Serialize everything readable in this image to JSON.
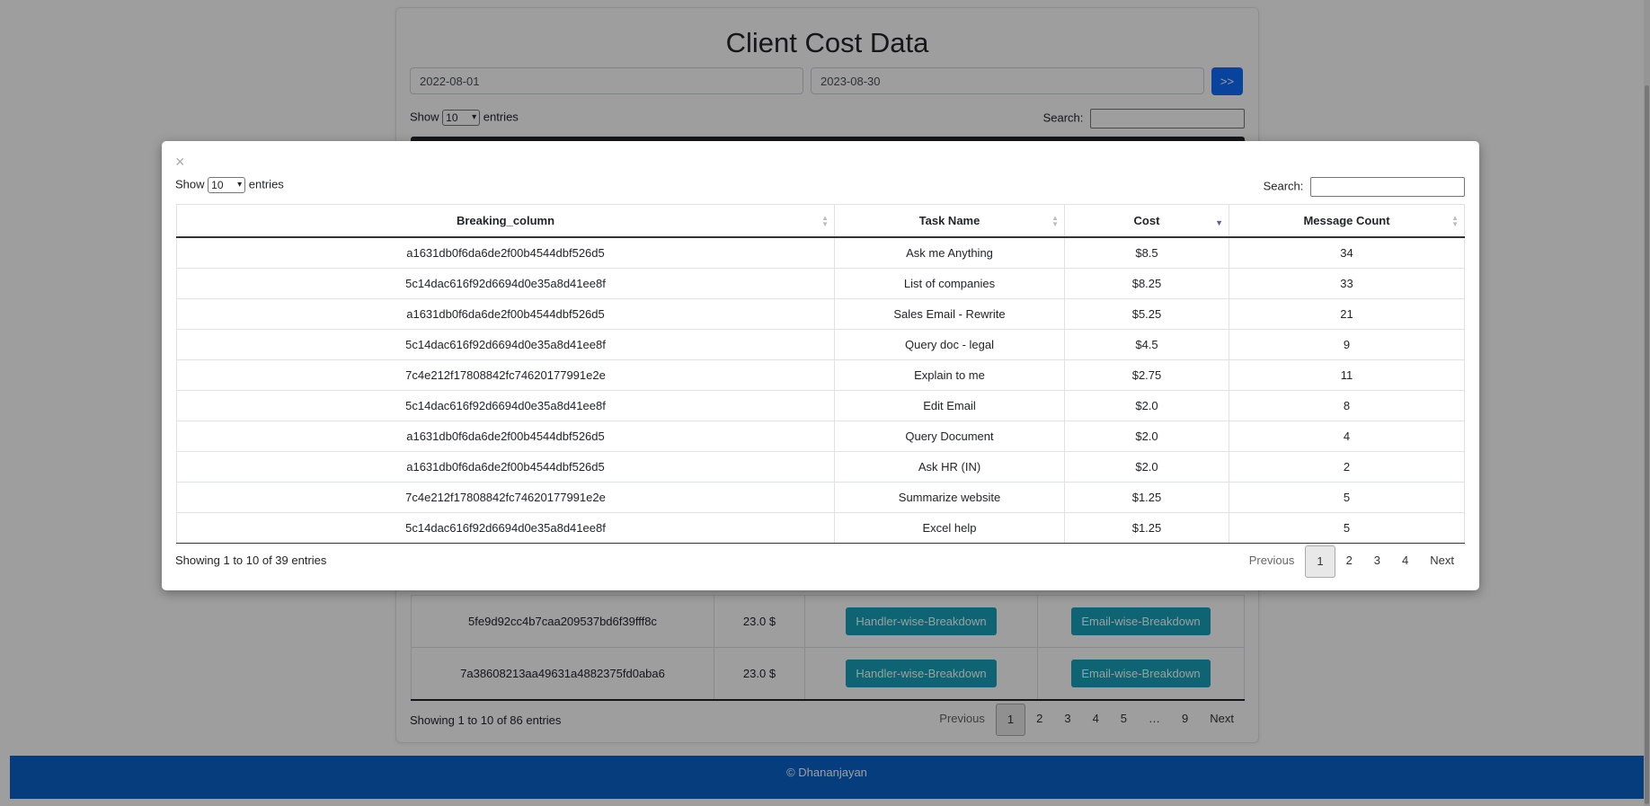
{
  "background": {
    "title": "Client Cost Data",
    "start_date": "2022-08-01",
    "end_date": "2023-08-30",
    "go_label": ">>",
    "length": {
      "show": "Show",
      "value": "10",
      "entries": "entries"
    },
    "search_label": "Search:",
    "rows": [
      {
        "id": "5fe9d92cc4b7caa209537bd6f39fff8c",
        "cost": "23.0 $",
        "handler_btn": "Handler-wise-Breakdown",
        "email_btn": "Email-wise-Breakdown"
      },
      {
        "id": "7a38608213aa49631a4882375fd0aba6",
        "cost": "23.0 $",
        "handler_btn": "Handler-wise-Breakdown",
        "email_btn": "Email-wise-Breakdown"
      }
    ],
    "info": "Showing 1 to 10 of 86 entries",
    "pagination": [
      "Previous",
      "1",
      "2",
      "3",
      "4",
      "5",
      "…",
      "9",
      "Next"
    ],
    "active_page": "1"
  },
  "footer": {
    "text": "© Dhananjayan"
  },
  "modal": {
    "close": "×",
    "length": {
      "show": "Show",
      "value": "10",
      "entries": "entries"
    },
    "search_label": "Search:",
    "columns": [
      "Breaking_column",
      "Task Name",
      "Cost",
      "Message Count"
    ],
    "rows": [
      [
        "a1631db0f6da6de2f00b4544dbf526d5",
        "Ask me Anything",
        "$8.5",
        "34"
      ],
      [
        "5c14dac616f92d6694d0e35a8d41ee8f",
        "List of companies",
        "$8.25",
        "33"
      ],
      [
        "a1631db0f6da6de2f00b4544dbf526d5",
        "Sales Email - Rewrite",
        "$5.25",
        "21"
      ],
      [
        "5c14dac616f92d6694d0e35a8d41ee8f",
        "Query doc - legal",
        "$4.5",
        "9"
      ],
      [
        "7c4e212f17808842fc74620177991e2e",
        "Explain to me",
        "$2.75",
        "11"
      ],
      [
        "5c14dac616f92d6694d0e35a8d41ee8f",
        "Edit Email",
        "$2.0",
        "8"
      ],
      [
        "a1631db0f6da6de2f00b4544dbf526d5",
        "Query Document",
        "$2.0",
        "4"
      ],
      [
        "a1631db0f6da6de2f00b4544dbf526d5",
        "Ask HR (IN)",
        "$2.0",
        "2"
      ],
      [
        "7c4e212f17808842fc74620177991e2e",
        "Summarize website",
        "$1.25",
        "5"
      ],
      [
        "5c14dac616f92d6694d0e35a8d41ee8f",
        "Excel help",
        "$1.25",
        "5"
      ]
    ],
    "info": "Showing 1 to 10 of 39 entries",
    "pagination": [
      "Previous",
      "1",
      "2",
      "3",
      "4",
      "Next"
    ],
    "active_page": "1"
  }
}
